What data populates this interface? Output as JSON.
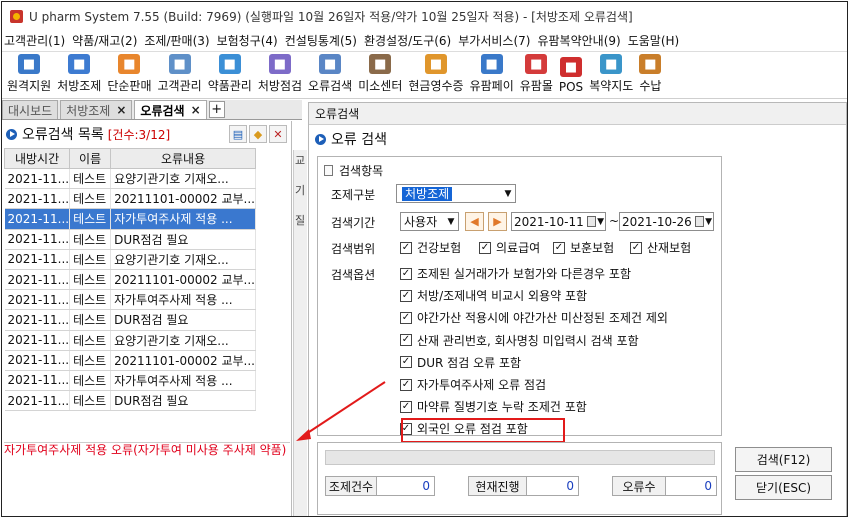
{
  "window": {
    "title": "U pharm System 7.55 (Build: 7969) (실행파일 10월 26일자 적용/약가 10월 25일자 적용) - [처방조제 오류검색]"
  },
  "menu": [
    "고객관리(1)",
    "약품/재고(2)",
    "조제/판매(3)",
    "보험청구(4)",
    "컨설팅통계(5)",
    "환경설정/도구(6)",
    "부가서비스(7)",
    "유팜복약안내(9)",
    "도움말(H)"
  ],
  "toolbar": [
    {
      "label": "원격지원",
      "icon": "remote-support-icon",
      "color": "#3a79c9"
    },
    {
      "label": "처방조제",
      "icon": "prescription-icon",
      "color": "#3d7bd1"
    },
    {
      "label": "단순판매",
      "icon": "simple-sale-icon",
      "color": "#e8862d"
    },
    {
      "label": "고객관리",
      "icon": "customer-icon",
      "color": "#5f90c8"
    },
    {
      "label": "약품관리",
      "icon": "drug-manage-icon",
      "color": "#3b8fd6"
    },
    {
      "label": "처방점검",
      "icon": "prescription-check-icon",
      "color": "#7d6bc8"
    },
    {
      "label": "오류검색",
      "icon": "error-search-icon",
      "color": "#5a86c5"
    },
    {
      "label": "미소센터",
      "icon": "miso-center-icon",
      "color": "#8a6a4a"
    },
    {
      "label": "현금영수증",
      "icon": "cash-receipt-icon",
      "color": "#e0962c"
    },
    {
      "label": "유팜페이",
      "icon": "upharm-pay-icon",
      "color": "#3a79c9"
    },
    {
      "label": "유팜몰",
      "icon": "upharm-mall-icon",
      "color": "#d43b3b"
    },
    {
      "label": "POS",
      "icon": "pos-icon",
      "color": "#cf2e2e"
    },
    {
      "label": "복약지도",
      "icon": "medication-guide-icon",
      "color": "#3a95c9"
    },
    {
      "label": "수납",
      "icon": "payment-icon",
      "color": "#c97e2a"
    }
  ],
  "tabs": [
    {
      "label": "대시보드",
      "active": false,
      "closable": false
    },
    {
      "label": "처방조제",
      "active": false,
      "closable": true
    },
    {
      "label": "오류검색",
      "active": true,
      "closable": true
    }
  ],
  "left": {
    "title": "오류검색 목록",
    "count": "[건수:3/12]",
    "columns": [
      "내방시간",
      "이름",
      "오류내용"
    ],
    "rows": [
      [
        "2021-11...",
        "테스트",
        "요양기관기호 기재오..."
      ],
      [
        "2021-11...",
        "테스트",
        "20211101-00002 교부..."
      ],
      [
        "2021-11...",
        "테스트",
        "자가투여주사제 적용 ..."
      ],
      [
        "2021-11...",
        "테스트",
        "DUR점검 필요"
      ],
      [
        "2021-11...",
        "테스트",
        "요양기관기호 기재오..."
      ],
      [
        "2021-11...",
        "테스트",
        "20211101-00002 교부..."
      ],
      [
        "2021-11...",
        "테스트",
        "자가투여주사제 적용 ..."
      ],
      [
        "2021-11...",
        "테스트",
        "DUR점검 필요"
      ],
      [
        "2021-11...",
        "테스트",
        "요양기관기호 기재오..."
      ],
      [
        "2021-11...",
        "테스트",
        "20211101-00002 교부..."
      ],
      [
        "2021-11...",
        "테스트",
        "자가투여주사제 적용 ..."
      ],
      [
        "2021-11...",
        "테스트",
        "DUR점검 필요"
      ]
    ],
    "selected_row": 2,
    "error_detail": "자가투여주사제 적용 오류(자가투여 미사용 주사제 약품)"
  },
  "mid": {
    "frag1": "교",
    "frag2": "기",
    "frag3": "질"
  },
  "dialog": {
    "window_title": "오류검색",
    "heading": "오류 검색",
    "group_title": "검색항목",
    "labels": {
      "type": "조제구분",
      "period": "검색기간",
      "range": "검색범위",
      "options": "검색옵션"
    },
    "type_value": "처방조제",
    "period_mode": "사용자",
    "date_from": "2021-10-11",
    "date_to": "2021-10-26",
    "range": [
      {
        "label": "건강보험",
        "checked": true
      },
      {
        "label": "의료급여",
        "checked": true
      },
      {
        "label": "보훈보험",
        "checked": true
      },
      {
        "label": "산재보험",
        "checked": true
      }
    ],
    "options": [
      {
        "label": "조제된 실거래가가 보험가와 다른경우 포함",
        "checked": true
      },
      {
        "label": "처방/조제내역 비교시 외용약 포함",
        "checked": true
      },
      {
        "label": "야간가산 적용시에 야간가산 미산정된 조제건 제외",
        "checked": true
      },
      {
        "label": "산재 관리번호, 회사명칭 미입력시 검색 포함",
        "checked": true
      },
      {
        "label": "DUR 점검 오류 포함",
        "checked": true
      },
      {
        "label": "자가투여주사제 오류 점검",
        "checked": true
      },
      {
        "label": "마약류 질병기호 누락 조제건 포함",
        "checked": true
      },
      {
        "label": "외국인 오류 점검 포함",
        "checked": true
      }
    ],
    "counters": [
      {
        "label": "조제건수",
        "value": "0"
      },
      {
        "label": "현재진행",
        "value": "0"
      },
      {
        "label": "오류수",
        "value": "0"
      }
    ],
    "search_button": "검색(F12)",
    "close_button": "닫기(ESC)"
  },
  "colors": {
    "accent": "#1565d6",
    "selection": "#3a78cf",
    "error": "#e0001b",
    "annotation": "#e21a1a"
  }
}
